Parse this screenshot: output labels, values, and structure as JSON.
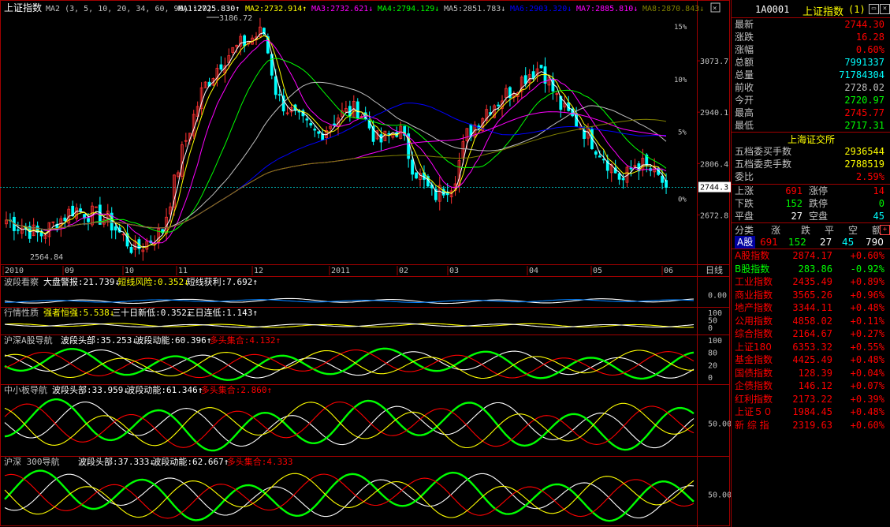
{
  "main_panel": {
    "title": "上证指数",
    "ma_header": "MA2 (3, 5, 10, 20, 34, 60, 90, 120)",
    "ma_values": [
      {
        "label": "MA1:",
        "value": "2725.830",
        "arrow": "↑",
        "color": "#ffffff"
      },
      {
        "label": "MA2:",
        "value": "2732.914",
        "arrow": "↑",
        "color": "#ffff00"
      },
      {
        "label": "MA3:",
        "value": "2732.621",
        "arrow": "↓",
        "color": "#ff00ff"
      },
      {
        "label": "MA4:",
        "value": "2794.129",
        "arrow": "↓",
        "color": "#00ff00"
      },
      {
        "label": "MA5:",
        "value": "2851.783",
        "arrow": "↓",
        "color": "#c0c0c0"
      },
      {
        "label": "MA6:",
        "value": "2903.320",
        "arrow": "↓",
        "color": "#0000ff"
      },
      {
        "label": "MA7:",
        "value": "2885.810",
        "arrow": "↓",
        "color": "#ff00ff"
      },
      {
        "label": "MA8:",
        "value": "2870.843",
        "arrow": "↓",
        "color": "#808000"
      }
    ],
    "high_label": "3186.72",
    "low_label": "2564.84",
    "right_axis_prices": [
      "3073.7",
      "2940.1",
      "2806.4",
      "2744.3",
      "2672.8"
    ],
    "right_axis_pcts": [
      "15%",
      "10%",
      "5%",
      "0%"
    ],
    "date_labels": [
      "2010",
      "09",
      "10",
      "11",
      "12",
      "2011",
      "02",
      "03",
      "04",
      "05",
      "06"
    ],
    "period": "日线"
  },
  "sub_panels": [
    {
      "title": "波段看察",
      "items": [
        {
          "text": "大盘警报:21.739",
          "arrow": "↓",
          "color": "#ffffff"
        },
        {
          "text": "短线风险:0.352",
          "arrow": "↓",
          "color": "#ffff00"
        },
        {
          "text": "短线获利:7.692",
          "arrow": "↑",
          "color": "#ffffff"
        }
      ],
      "axis": [
        "0.00"
      ]
    },
    {
      "title": "行情性质",
      "items": [
        {
          "text": "强者恒强:5.538",
          "arrow": "↓",
          "color": "#ffff00"
        },
        {
          "text": "三十日新低:0.352",
          "arrow": "↓",
          "color": "#ffffff"
        },
        {
          "text": "三日连低:1.143",
          "arrow": "↑",
          "color": "#ffffff"
        }
      ],
      "axis": [
        "100",
        "50",
        "0"
      ]
    },
    {
      "title": "沪深A股导航",
      "items": [
        {
          "text": "波段头部:35.253",
          "arrow": "↓",
          "color": "#ffffff"
        },
        {
          "text": "波段动能:60.396",
          "arrow": "↑",
          "color": "#ffffff"
        },
        {
          "text": "多头集合:4.132",
          "arrow": "↑",
          "color": "#ff0000"
        }
      ],
      "axis": [
        "100",
        "80",
        "20",
        "0"
      ]
    },
    {
      "title": "中小板导航",
      "items": [
        {
          "text": "波段头部:33.959",
          "arrow": "↓",
          "color": "#ffffff"
        },
        {
          "text": "波段动能:61.346",
          "arrow": "↑",
          "color": "#ffffff"
        },
        {
          "text": "多头集合:2.860",
          "arrow": "↑",
          "color": "#ff0000"
        }
      ],
      "axis": [
        "50.00"
      ]
    },
    {
      "title": "沪深 300导航",
      "items": [
        {
          "text": "波段头部:37.333",
          "arrow": "↓",
          "color": "#ffffff"
        },
        {
          "text": "波段动能:62.667",
          "arrow": "↑",
          "color": "#ffffff"
        },
        {
          "text": "多头集合:4.333",
          "arrow": "",
          "color": "#ff0000"
        }
      ],
      "axis": [
        "50.00"
      ]
    }
  ],
  "right_panel": {
    "code": "1A0001",
    "name": "上证指数",
    "tag": "(1)",
    "quote": [
      {
        "label": "最新",
        "value": "2744.30",
        "color": "#ff0000"
      },
      {
        "label": "涨跌",
        "value": "16.28",
        "color": "#ff0000"
      },
      {
        "label": "涨幅",
        "value": "0.60%",
        "color": "#ff0000"
      },
      {
        "label": "总额",
        "value": "7991337",
        "color": "#00ffff"
      },
      {
        "label": "总量",
        "value": "71784304",
        "color": "#00ffff"
      },
      {
        "label": "前收",
        "value": "2728.02",
        "color": "#c0c0c0"
      },
      {
        "label": "今开",
        "value": "2720.97",
        "color": "#00ff00"
      },
      {
        "label": "最高",
        "value": "2745.77",
        "color": "#ff0000"
      },
      {
        "label": "最低",
        "value": "2717.31",
        "color": "#00ff00"
      }
    ],
    "exchange": "上海证交所",
    "orders": [
      {
        "label": "五档委买手数",
        "value": "2936544",
        "color": "#ffff00"
      },
      {
        "label": "五档委卖手数",
        "value": "2788519",
        "color": "#ffff00"
      },
      {
        "label": "委比",
        "value": "2.59%",
        "color": "#ff0000"
      }
    ],
    "breadth": [
      {
        "l1": "上涨",
        "v1": "691",
        "c1": "#ff0000",
        "l2": "涨停",
        "v2": "14",
        "c2": "#ff0000"
      },
      {
        "l1": "下跌",
        "v1": "152",
        "c1": "#00ff00",
        "l2": "跌停",
        "v2": "0",
        "c2": "#00ff00"
      },
      {
        "l1": "平盘",
        "v1": "27",
        "c1": "#ffffff",
        "l2": "空盘",
        "v2": "45",
        "c2": "#00ffff"
      }
    ],
    "category_header": [
      "分类",
      "涨",
      "跌",
      "平",
      "空",
      "额"
    ],
    "category_row": {
      "name": "A股",
      "up": "691",
      "down": "152",
      "flat": "27",
      "empty": "45",
      "amount": "790"
    },
    "indices": [
      {
        "name": "A股指数",
        "value": "2874.17",
        "change": "+0.60%",
        "color": "#ff0000"
      },
      {
        "name": "B股指数",
        "value": "283.86",
        "change": "-0.92%",
        "color": "#00ff00"
      },
      {
        "name": "工业指数",
        "value": "2435.49",
        "change": "+0.89%",
        "color": "#ff0000"
      },
      {
        "name": "商业指数",
        "value": "3565.26",
        "change": "+0.96%",
        "color": "#ff0000"
      },
      {
        "name": "地产指数",
        "value": "3344.11",
        "change": "+0.48%",
        "color": "#ff0000"
      },
      {
        "name": "公用指数",
        "value": "4858.02",
        "change": "+0.11%",
        "color": "#ff0000"
      },
      {
        "name": "综合指数",
        "value": "2164.67",
        "change": "+0.27%",
        "color": "#ff0000"
      },
      {
        "name": "上证180",
        "value": "6353.32",
        "change": "+0.55%",
        "color": "#ff0000"
      },
      {
        "name": "基金指数",
        "value": "4425.49",
        "change": "+0.48%",
        "color": "#ff0000"
      },
      {
        "name": "国债指数",
        "value": "128.39",
        "change": "+0.04%",
        "color": "#ff0000"
      },
      {
        "name": "企债指数",
        "value": "146.12",
        "change": "+0.07%",
        "color": "#ff0000"
      },
      {
        "name": "红利指数",
        "value": "2173.22",
        "change": "+0.39%",
        "color": "#ff0000"
      },
      {
        "name": "上证５０",
        "value": "1984.45",
        "change": "+0.48%",
        "color": "#ff0000"
      },
      {
        "name": "新 综 指",
        "value": "2319.63",
        "change": "+0.60%",
        "color": "#ff0000"
      }
    ]
  }
}
